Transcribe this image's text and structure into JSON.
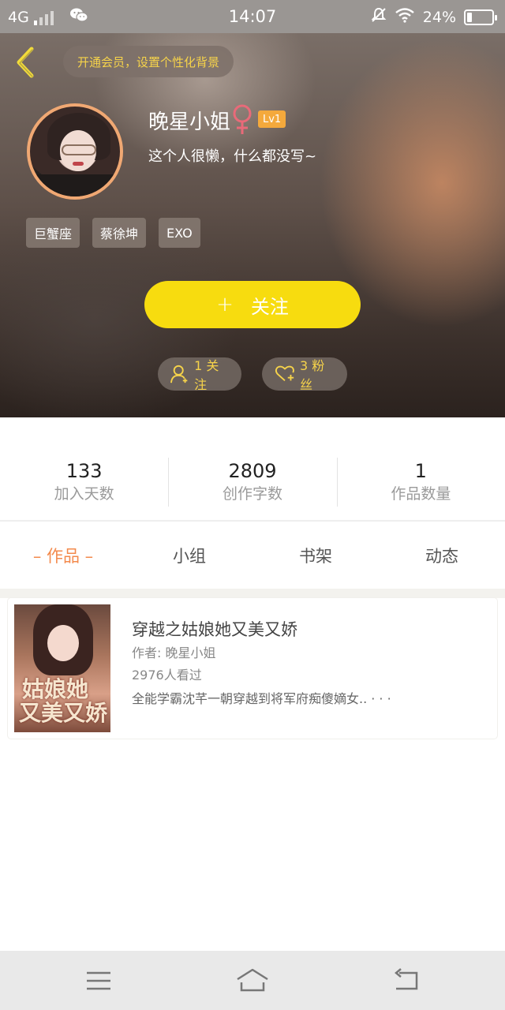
{
  "status_bar": {
    "network": "4G",
    "time": "14:07",
    "battery": "24%",
    "battery_level": 0.24,
    "icons": [
      "signal-icon",
      "wechat-icon",
      "mute-icon",
      "wifi-icon",
      "battery-icon"
    ]
  },
  "header": {
    "vip_prompt": "开通会员，设置个性化背景",
    "username": "晚星小姐",
    "gender_icon": "female-icon",
    "level": "Lv1",
    "bio": "这个人很懒，什么都没写~",
    "tags": [
      "巨蟹座",
      "蔡徐坤",
      "EXO"
    ],
    "follow_plus": "+",
    "follow_label": "关注",
    "following_label": "1 关注",
    "fans_label": "3 粉丝",
    "colors": {
      "accent_yellow": "#f7dc0f",
      "pill_text": "#f6d34a",
      "level_badge": "#f4a93c",
      "avatar_ring": "#f0a873"
    }
  },
  "stats": [
    {
      "value": "133",
      "label": "加入天数"
    },
    {
      "value": "2809",
      "label": "创作字数"
    },
    {
      "value": "1",
      "label": "作品数量"
    }
  ],
  "tabs": [
    {
      "label": "– 作品 –",
      "active": true
    },
    {
      "label": "小组",
      "active": false
    },
    {
      "label": "书架",
      "active": false
    },
    {
      "label": "动态",
      "active": false
    }
  ],
  "book": {
    "cover_line1": "姑娘她",
    "cover_line2": "又美又娇",
    "title": "穿越之姑娘她又美又娇",
    "author": "作者: 晚星小姐",
    "views": "2976人看过",
    "description": "全能学霸沈芊一朝穿越到将军府痴傻嫡女.. · · ·"
  },
  "nav": {
    "icons": [
      "menu-icon",
      "home-icon",
      "back-icon"
    ]
  },
  "colors": {
    "active_tab": "#f38a4c"
  }
}
